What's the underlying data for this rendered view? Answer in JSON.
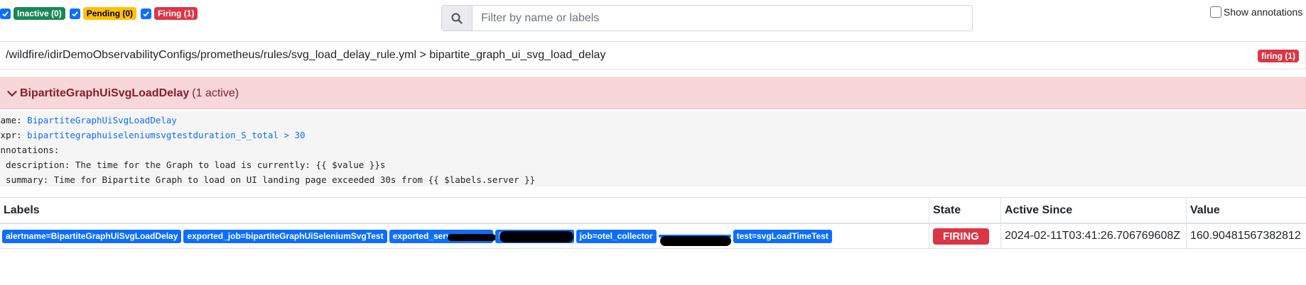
{
  "filters": [
    {
      "label": "Inactive (0)",
      "checked": true,
      "color": "#198754"
    },
    {
      "label": "Pending (0)",
      "checked": true,
      "color": "#ffc107"
    },
    {
      "label": "Firing (1)",
      "checked": true,
      "color": "#dc3545"
    }
  ],
  "search": {
    "placeholder": "Filter by name or labels",
    "icon": "search-icon"
  },
  "show_annotations": {
    "label": "Show annotations",
    "checked": false
  },
  "group": {
    "path": "/wildfire/idirDemoObservabilityConfigs/prometheus/rules/svg_load_delay_rule.yml > bipartite_graph_ui_svg_load_delay",
    "badge": "firing (1)"
  },
  "alert": {
    "name": "BipartiteGraphUiSvgLoadDelay",
    "active_count": "(1 active)"
  },
  "rule": {
    "name_key": "name:",
    "name_value": "BipartiteGraphUiSvgLoadDelay",
    "expr_key": "expr:",
    "expr_value": "bipartitegraphuiseleniumsvgtestduration_S_total > 30",
    "annotations_key": "annotations:",
    "description_line": "  description: The time for the Graph to load is currently: {{ $value }}s",
    "summary_line": "  summary: Time for Bipartite Graph to load on UI landing page exceeded 30s from {{ $labels.server }}"
  },
  "table": {
    "headers": [
      "Labels",
      "State",
      "Active Since",
      "Value"
    ],
    "labels": [
      "alertname=BipartiteGraphUiSvgLoadDelay",
      "exported_job=bipartiteGraphUiSeleniumSvgTest",
      "exported_server",
      "i",
      "job=otel_collector",
      "",
      "test=svgLoadTimeTest"
    ],
    "state": "FIRING",
    "active_since": "2024-02-11T03:41:26.706769608Z",
    "value": "160.90481567382812"
  }
}
